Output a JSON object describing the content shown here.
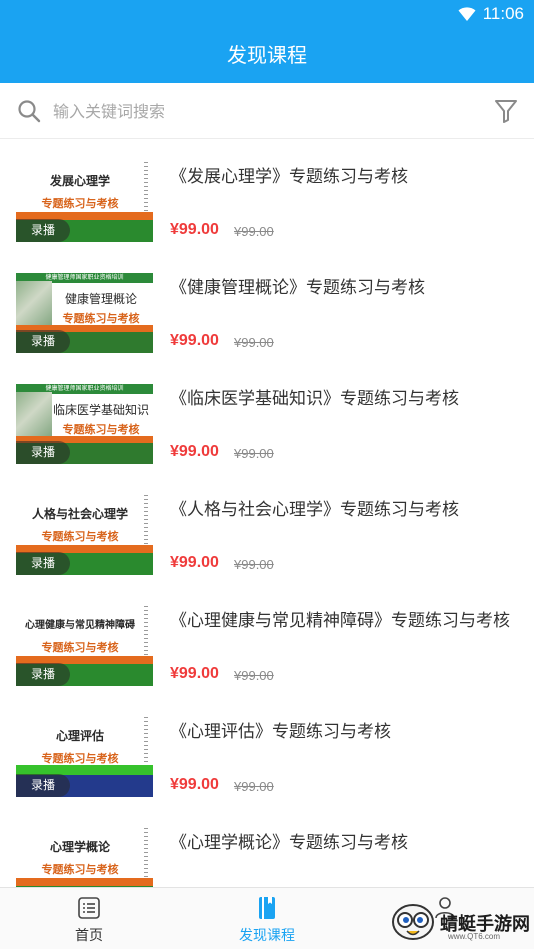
{
  "status_bar": {
    "time": "11:06",
    "wifi_icon": "wifi-icon"
  },
  "header": {
    "title": "发现课程"
  },
  "search": {
    "placeholder": "输入关键词搜索",
    "icon": "search-icon",
    "filter_icon": "filter-icon"
  },
  "courses": [
    {
      "cover_title": "发展心理学",
      "cover_sub": "专题练习与考核",
      "badge": "录播",
      "title": "《发展心理学》专题练习与考核",
      "price": "¥99.00",
      "original_price": "¥99.00"
    },
    {
      "cover_banner": "健康管理师国家职业资格培训",
      "cover_title": "健康管理概论",
      "cover_sub": "专题练习与考核",
      "badge": "录播",
      "title": "《健康管理概论》专题练习与考核",
      "price": "¥99.00",
      "original_price": "¥99.00"
    },
    {
      "cover_banner": "健康管理师国家职业资格培训",
      "cover_title": "临床医学基础知识",
      "cover_sub": "专题练习与考核",
      "badge": "录播",
      "title": "《临床医学基础知识》专题练习与考核",
      "price": "¥99.00",
      "original_price": "¥99.00"
    },
    {
      "cover_title": "人格与社会心理学",
      "cover_sub": "专题练习与考核",
      "badge": "录播",
      "title": "《人格与社会心理学》专题练习与考核",
      "price": "¥99.00",
      "original_price": "¥99.00"
    },
    {
      "cover_title": "心理健康与常见精神障碍",
      "cover_sub": "专题练习与考核",
      "badge": "录播",
      "title": "《心理健康与常见精神障碍》专题练习与考核",
      "price": "¥99.00",
      "original_price": "¥99.00"
    },
    {
      "cover_title": "心理评估",
      "cover_sub": "专题练习与考核",
      "badge": "录播",
      "title": "《心理评估》专题练习与考核",
      "price": "¥99.00",
      "original_price": "¥99.00"
    },
    {
      "cover_title": "心理学概论",
      "cover_sub": "专题练习与考核",
      "title": "《心理学概论》专题练习与考核"
    }
  ],
  "tabs": [
    {
      "label": "首页",
      "icon": "list-icon",
      "active": false
    },
    {
      "label": "发现课程",
      "icon": "book-icon",
      "active": true
    },
    {
      "label": "",
      "icon": "user-icon",
      "active": false
    }
  ],
  "watermark": {
    "text": "蜻蜓手游网",
    "url": "www.QT6.com"
  },
  "colors": {
    "primary": "#1aa3f2",
    "price": "#ef3b3b",
    "cover_orange": "#e46b1e",
    "cover_green": "#2a8a2e"
  }
}
